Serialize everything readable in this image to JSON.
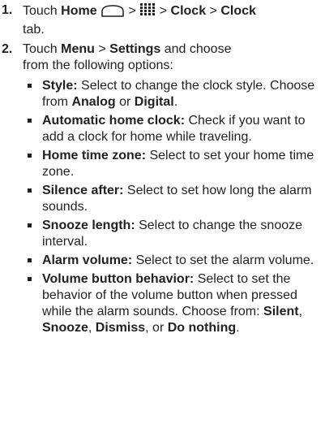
{
  "steps": [
    {
      "number": "1.",
      "parts": {
        "touch": "Touch ",
        "home": "Home",
        "sep1": " > ",
        "sep2": " > ",
        "clock": "Clock",
        "sep3": " > ",
        "clock_tab": "Clock",
        "tab": "tab."
      },
      "icons": [
        "home-icon",
        "apps-grid-icon"
      ]
    },
    {
      "number": "2.",
      "parts": {
        "touch": "Touch ",
        "menu": "Menu",
        "sep": " > ",
        "settings": "Settings",
        "rest_line1": " and choose",
        "rest_line2": "from the following options:"
      }
    }
  ],
  "options": [
    {
      "label": "Style:",
      "desc": " Select to change the clock style. Choose from ",
      "opt1": "Analog",
      "or": " or ",
      "opt2": "Digital",
      "end": "."
    },
    {
      "label": "Automatic home clock:",
      "desc": " Check if you want to add a clock for home while traveling."
    },
    {
      "label": "Home time zone:",
      "desc": " Select to set your home time zone."
    },
    {
      "label": "Silence after:",
      "desc": " Select to set how long the alarm sounds."
    },
    {
      "label": "Snooze length:",
      "desc": " Select to change the snooze interval."
    },
    {
      "label": "Alarm volume:",
      "desc": " Select to set the alarm volume."
    },
    {
      "label": "Volume button behavior:",
      "desc": " Select to set the behavior of the volume button when pressed while the alarm sounds. Choose from: ",
      "c1": "Silent",
      "s1": ", ",
      "c2": "Snooze",
      "s2": ", ",
      "c3": "Dismiss",
      "s3": ", or ",
      "c4": "Do nothing",
      "end": "."
    }
  ]
}
